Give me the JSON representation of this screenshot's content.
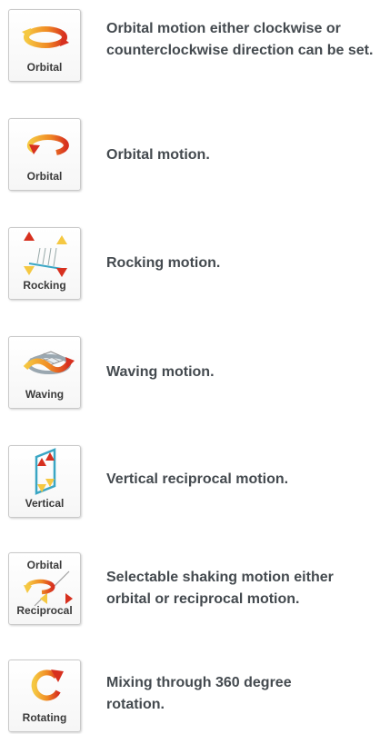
{
  "modes": [
    {
      "label": "Orbital",
      "description_lines": [
        "Orbital motion either clockwise or",
        "counterclockwise direction can be set."
      ]
    },
    {
      "label": "Orbital",
      "description_lines": [
        "Orbital motion."
      ]
    },
    {
      "label": "Rocking",
      "description_lines": [
        "Rocking motion."
      ]
    },
    {
      "label": "Waving",
      "description_lines": [
        "Waving motion."
      ]
    },
    {
      "label": "Vertical",
      "description_lines": [
        "Vertical reciprocal motion."
      ]
    },
    {
      "label_top": "Orbital",
      "label_bottom": "Reciprocal",
      "description_lines": [
        "Selectable shaking motion either",
        "orbital or reciprocal motion."
      ]
    },
    {
      "label": "Rotating",
      "description_lines": [
        "Mixing through 360 degree",
        "rotation."
      ]
    }
  ],
  "icons": [
    "orbital-bidirectional-icon",
    "orbital-icon",
    "rocking-icon",
    "waving-icon",
    "vertical-icon",
    "orbital-reciprocal-icon",
    "rotating-icon"
  ],
  "colors": {
    "accent_yellow": "#f2c230",
    "accent_orange": "#ee6a1c",
    "accent_red": "#d7301f",
    "accent_teal": "#3aa6c4",
    "text": "#444a4f"
  }
}
